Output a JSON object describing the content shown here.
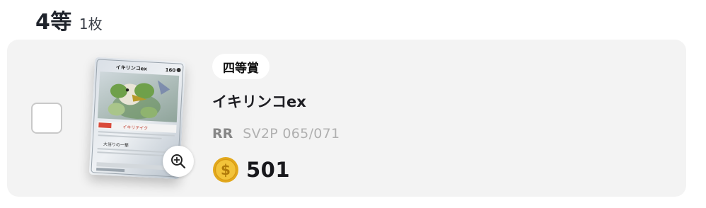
{
  "heading": {
    "rank": "4等",
    "count": "1枚"
  },
  "prize": {
    "tag": "四等賞",
    "card_name": "イキリンコex",
    "rarity": "RR",
    "code": "SV2P 065/071",
    "points": "501"
  },
  "card_art": {
    "title": "イキリンコex",
    "hp": "160",
    "attack_1": "イキリテイク",
    "attack_2": "大当りの一撃"
  },
  "icons": {
    "zoom": "zoom-in-icon",
    "coin": "coin-icon",
    "checkbox": "checkbox-unchecked"
  },
  "colors": {
    "panel": "#f3f3f3",
    "coin": "#e8b421",
    "text_primary": "#1d1d22",
    "text_muted": "#b0b0b0"
  }
}
